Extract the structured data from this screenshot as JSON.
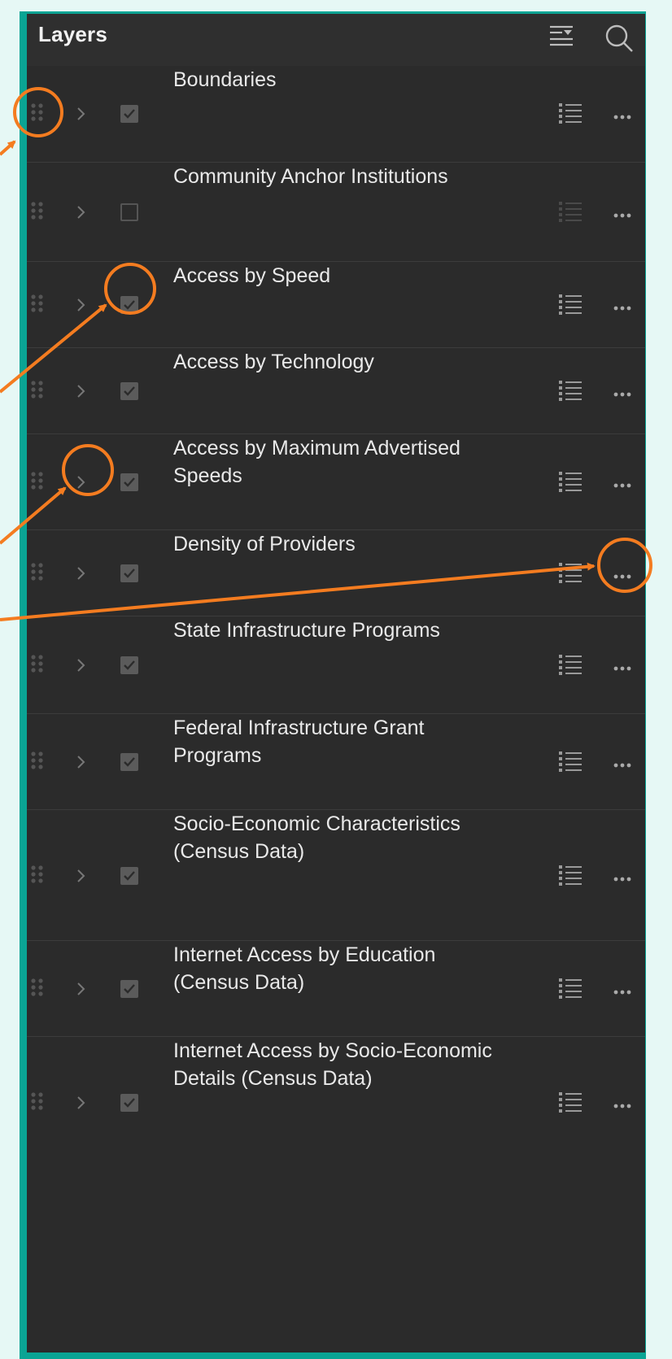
{
  "panel": {
    "title": "Layers",
    "header_icons": [
      "list-options-icon",
      "search-icon"
    ]
  },
  "layers": [
    {
      "label": "Boundaries",
      "checked": true
    },
    {
      "label": "Community Anchor Institutions",
      "checked": false
    },
    {
      "label": "Access by Speed",
      "checked": true
    },
    {
      "label": "Access by Technology",
      "checked": true
    },
    {
      "label": "Access by Maximum Advertised Speeds",
      "checked": true
    },
    {
      "label": "Density of Providers",
      "checked": true
    },
    {
      "label": "State Infrastructure Programs",
      "checked": true
    },
    {
      "label": "Federal Infrastructure Grant Programs",
      "checked": true
    },
    {
      "label": "Socio-Economic Characteristics (Census Data)",
      "checked": true
    },
    {
      "label": "Internet Access by Education (Census Data)",
      "checked": true
    },
    {
      "label": "Internet Access by Socio-Economic Details (Census Data)",
      "checked": true
    }
  ],
  "row_icons": {
    "handle": "drag-handle-icon",
    "expand": "chevron-right-icon",
    "legend": "legend-icon",
    "menu": "more-options-icon"
  },
  "colors": {
    "frame": "#0aa494",
    "panel": "#2b2b2b",
    "annotation": "#f47c20",
    "text": "#e9e9e9"
  }
}
